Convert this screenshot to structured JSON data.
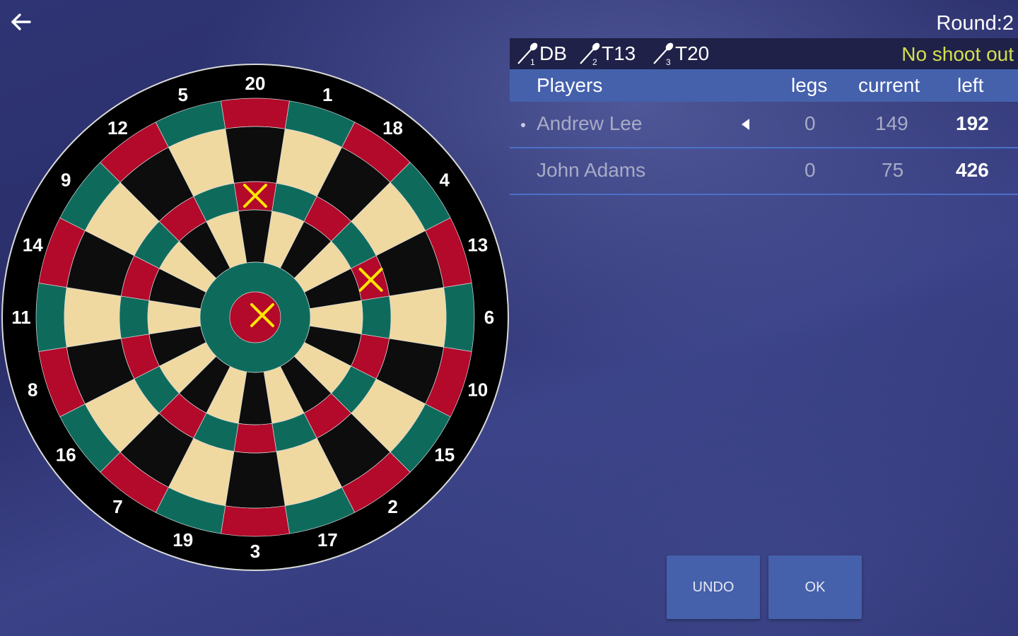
{
  "header": {
    "back_icon": "arrow-left-icon",
    "round_label": "Round:2"
  },
  "throws": [
    {
      "index": "1",
      "label": "DB",
      "icon": "dart-icon"
    },
    {
      "index": "2",
      "label": "T13",
      "icon": "dart-icon"
    },
    {
      "index": "3",
      "label": "T20",
      "icon": "dart-icon"
    }
  ],
  "shootout_label": "No shoot out",
  "table": {
    "headers": {
      "players": "Players",
      "legs": "legs",
      "current": "current",
      "left": "left"
    },
    "rows": [
      {
        "name": "Andrew Lee",
        "legs": "0",
        "current": "149",
        "left": "192",
        "active": true
      },
      {
        "name": "John Adams",
        "legs": "0",
        "current": "75",
        "left": "426",
        "active": false
      }
    ]
  },
  "dartboard": {
    "numbers": [
      "20",
      "1",
      "18",
      "4",
      "13",
      "6",
      "10",
      "15",
      "2",
      "17",
      "3",
      "19",
      "7",
      "16",
      "8",
      "11",
      "14",
      "9",
      "12",
      "5"
    ],
    "hits": [
      "DB",
      "T13",
      "T20"
    ],
    "colors": {
      "black": "#0d0d0d",
      "cream": "#f0d9a0",
      "red": "#b3092a",
      "green": "#0e6b5c",
      "hit_marker": "#ffe600",
      "surround": "#000000",
      "wire": "#d9d9d9"
    }
  },
  "buttons": {
    "undo": "UNDO",
    "ok": "OK"
  },
  "colors": {
    "background": "#2f3474",
    "header_bar": "#4561ac",
    "throw_bar": "#1f2148",
    "shootout_text": "#d4e04c",
    "row_divider": "#4c70c8"
  }
}
